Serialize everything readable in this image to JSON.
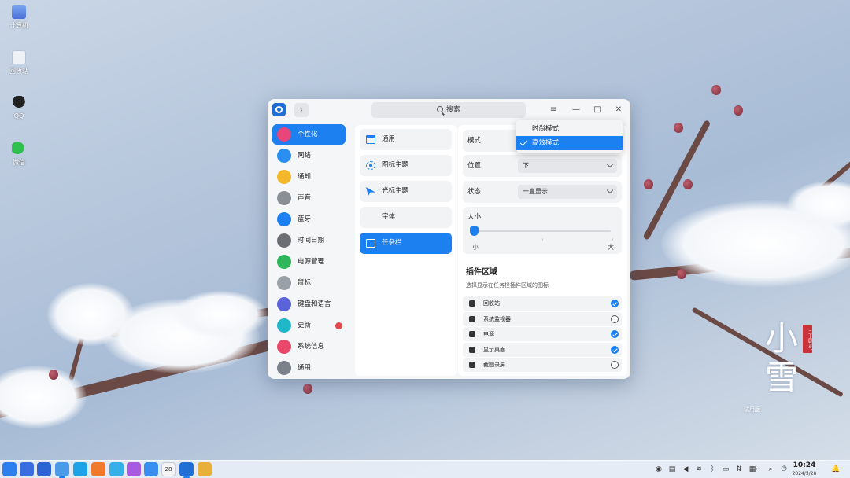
{
  "desktop": {
    "icons": [
      {
        "label": "计算机",
        "icon": "computer-icon"
      },
      {
        "label": "回收站",
        "icon": "trash-icon"
      },
      {
        "label": "QQ",
        "icon": "qq-icon"
      },
      {
        "label": "微信",
        "icon": "wechat-icon"
      }
    ],
    "wallpaper_text": {
      "title_line1": "小",
      "title_line2": "雪",
      "seal": "二十四节气",
      "caption": "试用版"
    }
  },
  "window": {
    "search_placeholder": "搜索",
    "menu_glyph": "≡",
    "minimize_glyph": "—",
    "maximize_glyph": "□",
    "close_glyph": "✕",
    "back_glyph": "‹",
    "sidebar": [
      {
        "label": "个性化",
        "icon": "personalization-icon",
        "color": "#e8457a",
        "active": true
      },
      {
        "label": "网络",
        "icon": "network-icon",
        "color": "#2a8ef0"
      },
      {
        "label": "通知",
        "icon": "bell-icon",
        "color": "#f3b72b"
      },
      {
        "label": "声音",
        "icon": "speaker-icon",
        "color": "#8a8f96"
      },
      {
        "label": "蓝牙",
        "icon": "bluetooth-icon",
        "color": "#1d80f0"
      },
      {
        "label": "时间日期",
        "icon": "clock-icon",
        "color": "#6c6f74"
      },
      {
        "label": "电源管理",
        "icon": "power-icon",
        "color": "#2fb55a"
      },
      {
        "label": "鼠标",
        "icon": "mouse-icon",
        "color": "#9aa0a8"
      },
      {
        "label": "键盘和语言",
        "icon": "keyboard-icon",
        "color": "#5a64d8"
      },
      {
        "label": "更新",
        "icon": "update-icon",
        "color": "#20b7c8",
        "badge": true
      },
      {
        "label": "系统信息",
        "icon": "info-icon",
        "color": "#e8486a"
      },
      {
        "label": "通用",
        "icon": "general-icon",
        "color": "#7c828a"
      }
    ],
    "personalization_menu": [
      {
        "label": "通用",
        "icon": "window-icon"
      },
      {
        "label": "图标主题",
        "icon": "snowflake-icon"
      },
      {
        "label": "光标主题",
        "icon": "cursor-icon"
      },
      {
        "label": "字体",
        "icon": "font-icon"
      },
      {
        "label": "任务栏",
        "icon": "taskbar-icon",
        "active": true
      }
    ],
    "taskbar_settings": {
      "mode_label": "模式",
      "position_label": "位置",
      "position_value": "下",
      "status_label": "状态",
      "status_value": "一直显示",
      "size_label": "大小",
      "size_min": "小",
      "size_max": "大",
      "size_value_fraction": 0.0,
      "plugin_title": "插件区域",
      "plugin_subtitle": "选择显示在任务栏插件区域的图标",
      "plugins": [
        {
          "label": "回收站",
          "icon": "trash-icon",
          "checked": true
        },
        {
          "label": "系统监视器",
          "icon": "monitor-icon",
          "checked": false
        },
        {
          "label": "电源",
          "icon": "power-icon",
          "checked": true
        },
        {
          "label": "显示桌面",
          "icon": "desktop-icon",
          "checked": true
        },
        {
          "label": "截图录屏",
          "icon": "screenshot-icon",
          "checked": false
        }
      ]
    },
    "mode_dropdown": {
      "options": [
        {
          "label": "时尚模式",
          "checked": false
        },
        {
          "label": "高效模式",
          "checked": true
        }
      ]
    }
  },
  "taskbar": {
    "apps": [
      {
        "name": "launcher-icon",
        "color": "#2d7ff0"
      },
      {
        "name": "multitask-icon",
        "color": "#3a6ee0"
      },
      {
        "name": "desktop-show-icon",
        "color": "#2c64d4"
      },
      {
        "name": "file-manager-icon",
        "color": "#4a9ae8"
      },
      {
        "name": "browser-icon",
        "color": "#1fa3e8"
      },
      {
        "name": "app-store-icon",
        "color": "#f07a2a"
      },
      {
        "name": "image-viewer-icon",
        "color": "#36b0e8"
      },
      {
        "name": "music-icon",
        "color": "#a85ae0"
      },
      {
        "name": "contacts-icon",
        "color": "#3a8ef0"
      },
      {
        "name": "calendar-icon",
        "color": "#f4f4f4",
        "text": "28"
      },
      {
        "name": "control-center-icon",
        "color": "#1f6fd4"
      },
      {
        "name": "theme-icon",
        "color": "#e8b03a"
      }
    ],
    "tray": [
      {
        "name": "update-tray-icon",
        "glyph": "◉"
      },
      {
        "name": "keyboard-tray-icon",
        "glyph": "▤"
      },
      {
        "name": "volume-icon",
        "glyph": "◀"
      },
      {
        "name": "wifi-icon",
        "glyph": "≋"
      },
      {
        "name": "bluetooth-tray-icon",
        "glyph": "ᛒ"
      },
      {
        "name": "battery-icon",
        "glyph": "▭"
      },
      {
        "name": "network-tray-icon",
        "glyph": "⇅"
      },
      {
        "name": "display-tray-icon",
        "glyph": "▦"
      },
      {
        "name": "expand-tray-icon",
        "glyph": "›"
      },
      {
        "name": "search-tray-icon",
        "glyph": "⌕"
      },
      {
        "name": "power-tray-icon",
        "glyph": "⏻"
      },
      {
        "name": "notification-icon",
        "glyph": "🔔"
      }
    ],
    "time": "10:24",
    "date": "2024/5/28"
  }
}
